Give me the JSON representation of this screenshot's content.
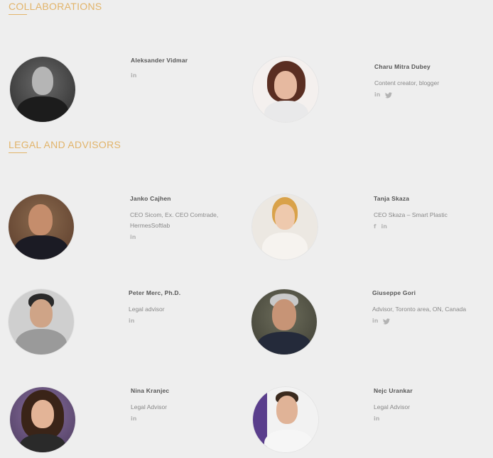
{
  "sections": {
    "collaborations": "COLLABORATIONS",
    "legal": "LEGAL AND ADVISORS"
  },
  "colors": {
    "accent": "#e2b46a",
    "background": "#eeeeee",
    "icon": "#b3b3b3"
  },
  "icons": {
    "linkedin": "in",
    "facebook": "f",
    "twitter": "twitter-icon"
  },
  "people": [
    {
      "name": "Aleksander Vidmar",
      "role": "",
      "social": [
        "linkedin"
      ]
    },
    {
      "name": "Charu Mitra Dubey",
      "role": "Content creator, blogger",
      "social": [
        "linkedin",
        "twitter"
      ]
    },
    {
      "name": "Janko Cajhen",
      "role": "CEO Sicom, Ex. CEO Comtrade, HermesSoftlab",
      "social": [
        "linkedin"
      ]
    },
    {
      "name": "Tanja Skaza",
      "role": "CEO Skaza – Smart Plastic",
      "social": [
        "facebook",
        "linkedin"
      ]
    },
    {
      "name": "Peter Merc, Ph.D.",
      "role": "Legal advisor",
      "social": [
        "linkedin"
      ]
    },
    {
      "name": "Giuseppe Gori",
      "role": "Advisor, Toronto area, ON, Canada",
      "social": [
        "linkedin",
        "twitter"
      ]
    },
    {
      "name": "Nina Kranjec",
      "role": "Legal Advisor",
      "social": [
        "linkedin"
      ]
    },
    {
      "name": "Nejc Urankar",
      "role": "Legal Advisor",
      "social": [
        "linkedin"
      ]
    }
  ]
}
